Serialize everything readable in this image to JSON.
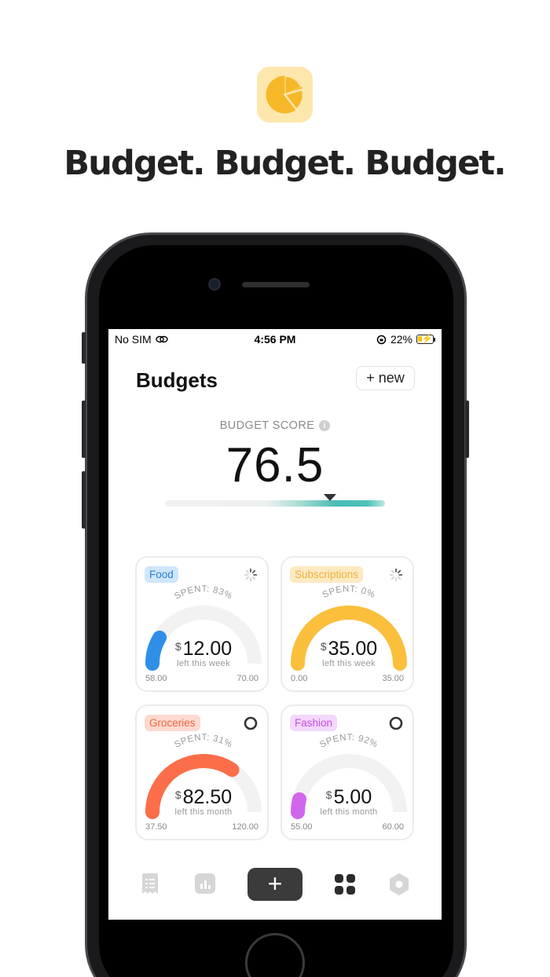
{
  "promo": {
    "app_icon": "pie-chart-icon",
    "headline": "Budget. Budget. Budget."
  },
  "status_bar": {
    "carrier": "No SIM",
    "wifi_icon": "wifi-icon",
    "time": "4:56 PM",
    "orientation_icon": "orientation-lock-icon",
    "battery": "22%",
    "battery_icon": "battery-charging-icon"
  },
  "header": {
    "title": "Budgets",
    "new_button": {
      "plus": "+",
      "label": "new"
    }
  },
  "score": {
    "label": "BUDGET SCORE",
    "info_icon": "i",
    "value": "76.5",
    "level": 0.75
  },
  "budgets": [
    {
      "name": "Food",
      "spent_label": "SPENT: 83%",
      "spent_fraction": 0.83,
      "currency": "$",
      "amount": "12.00",
      "period": "left this week",
      "min": "58.00",
      "max": "70.00",
      "color": "#2f8fe6",
      "label_bg": "#cfe6fb",
      "label_color": "#2a7fd4",
      "status_icon": "loading-spinner-icon"
    },
    {
      "name": "Subscriptions",
      "spent_label": "SPENT: 0%",
      "spent_fraction": 0.0,
      "currency": "$",
      "amount": "35.00",
      "period": "left this week",
      "min": "0.00",
      "max": "35.00",
      "color": "#fbbf3c",
      "label_bg": "#fde9c2",
      "label_color": "#eeb43d",
      "status_icon": "loading-spinner-icon"
    },
    {
      "name": "Groceries",
      "spent_label": "SPENT: 31%",
      "spent_fraction": 0.31,
      "currency": "$",
      "amount": "82.50",
      "period": "left this month",
      "min": "37.50",
      "max": "120.00",
      "color": "#fb6e49",
      "label_bg": "#fdd9cf",
      "label_color": "#ee6844",
      "status_icon": "progress-ring-icon"
    },
    {
      "name": "Fashion",
      "spent_label": "SPENT: 92%",
      "spent_fraction": 0.92,
      "currency": "$",
      "amount": "5.00",
      "period": "left this month",
      "min": "55.00",
      "max": "60.00",
      "color": "#d166ec",
      "label_bg": "#f3d8fb",
      "label_color": "#c94de4",
      "status_icon": "progress-ring-icon"
    }
  ],
  "tab_bar": {
    "items": [
      "receipt-icon",
      "bar-chart-icon",
      "add-icon",
      "apps-grid-icon",
      "settings-hexagon-icon"
    ],
    "add_label": "+"
  },
  "colors": {
    "gauge_track": "#f2f2f2",
    "score_gradient": "#45bcb4",
    "icon_bg": "#fde7ad",
    "icon_fg": "#f6b829"
  }
}
